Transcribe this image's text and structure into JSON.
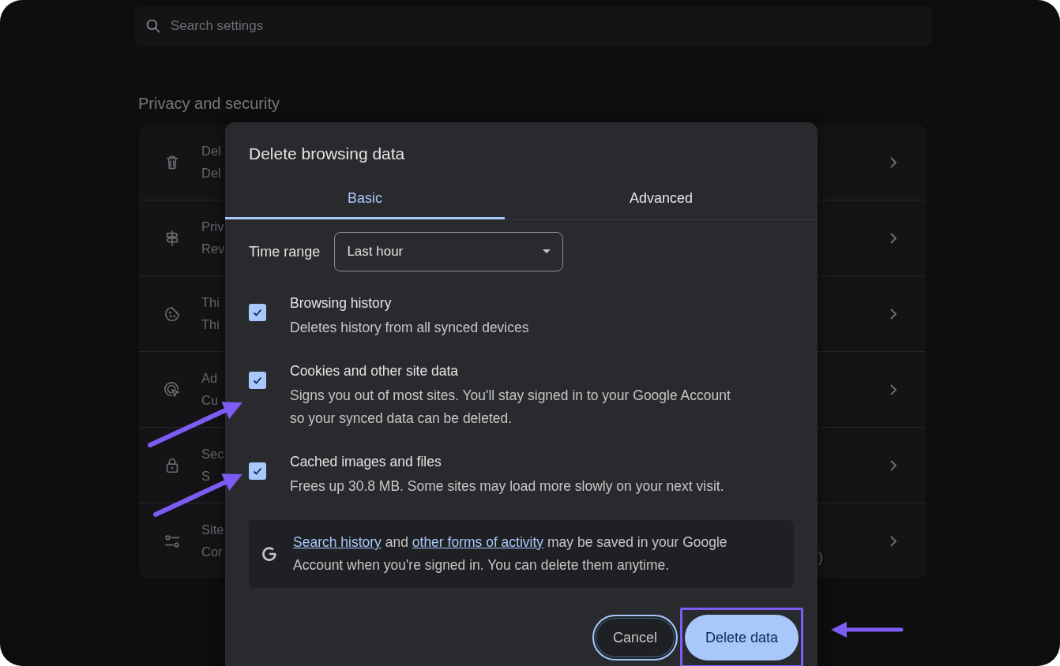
{
  "search": {
    "placeholder": "Search settings"
  },
  "section_title": "Privacy and security",
  "settings_rows": [
    {
      "title": "Del",
      "subtitle": "Del"
    },
    {
      "title": "Priv",
      "subtitle": "Rev"
    },
    {
      "title": "Thi",
      "subtitle": "Thi"
    },
    {
      "title": "Ad",
      "subtitle": "Cu"
    },
    {
      "title": "Sec",
      "subtitle": "S"
    },
    {
      "title": "Site",
      "subtitle": "Cor",
      "trailing": ")"
    }
  ],
  "dialog": {
    "title": "Delete browsing data",
    "tabs": [
      {
        "label": "Basic",
        "selected": true
      },
      {
        "label": "Advanced",
        "selected": false
      }
    ],
    "time_range": {
      "label": "Time range",
      "value": "Last hour"
    },
    "options": [
      {
        "title": "Browsing history",
        "description": "Deletes history from all synced devices",
        "checked": true
      },
      {
        "title": "Cookies and other site data",
        "description": "Signs you out of most sites. You'll stay signed in to your Google Account so your synced data can be deleted.",
        "checked": true
      },
      {
        "title": "Cached images and files",
        "description": "Frees up 30.8 MB. Some sites may load more slowly on your next visit.",
        "checked": true
      }
    ],
    "info": {
      "segments": [
        {
          "text": "Search history",
          "kind": "link"
        },
        {
          "text": " and ",
          "kind": "text"
        },
        {
          "text": "other forms of activity",
          "kind": "link"
        },
        {
          "text": " may be saved in your Google Account when you're signed in. You can delete them anytime.",
          "kind": "text"
        }
      ]
    },
    "buttons": [
      {
        "label": "Cancel",
        "kind": "outlined",
        "highlighted": false
      },
      {
        "label": "Delete data",
        "kind": "filled",
        "highlighted": true
      }
    ]
  }
}
